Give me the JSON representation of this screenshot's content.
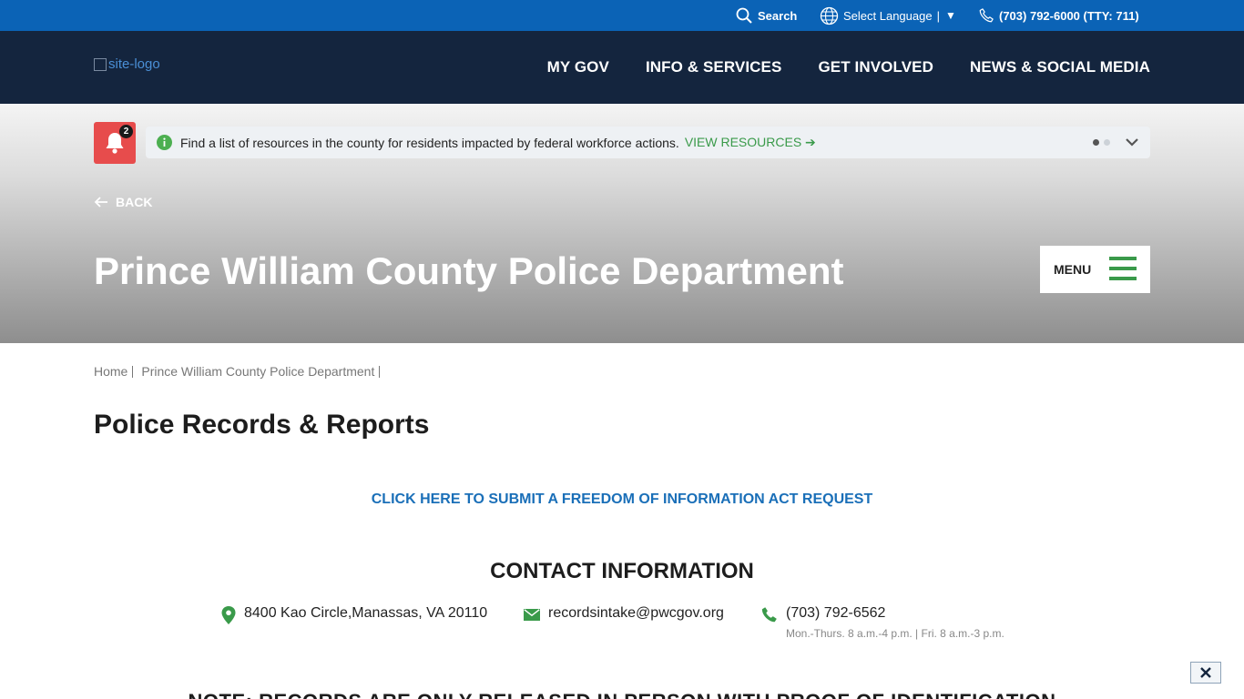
{
  "utility": {
    "search_label": "Search",
    "language_label": "Select Language",
    "language_separator": "|",
    "language_caret": "▼",
    "phone_label": "(703) 792-6000 (TTY: 711)"
  },
  "header": {
    "logo_alt": "site-logo",
    "nav": [
      {
        "label": "MY GOV"
      },
      {
        "label": "INFO & SERVICES"
      },
      {
        "label": "GET INVOLVED"
      },
      {
        "label": "NEWS & SOCIAL MEDIA"
      }
    ]
  },
  "alert": {
    "count": "2",
    "message": "Find a list of resources in the county for residents impacted by federal workforce actions.",
    "link_label": "VIEW RESOURCES ➔"
  },
  "hero": {
    "back_label": "BACK",
    "title": "Prince William County Police Department",
    "menu_label": "MENU"
  },
  "breadcrumb": [
    {
      "label": "Home"
    },
    {
      "label": "Prince William County Police Department"
    }
  ],
  "page": {
    "heading": "Police Records & Reports",
    "foia_link": "CLICK HERE TO SUBMIT A FREEDOM OF INFORMATION ACT REQUEST",
    "contact_heading": "CONTACT INFORMATION",
    "address": "8400 Kao Circle,Manassas, VA 20110",
    "email": "recordsintake@pwcgov.org",
    "phone": "(703) 792-6562",
    "hours": "Mon.-Thurs. 8 a.m.-4 p.m. | Fri. 8 a.m.-3 p.m.",
    "note": "NOTE: RECORDS ARE ONLY RELEASED IN PERSON WITH PROOF OF IDENTIFICATION"
  },
  "colors": {
    "utility_bar": "#0b63b6",
    "nav_bar": "#14253e",
    "accent_green": "#3a9a4a",
    "alert_red": "#e74c4c",
    "link_blue": "#1a6fb8"
  },
  "icons": {
    "search": "search-icon",
    "globe": "globe-icon",
    "phone": "phone-icon",
    "bell": "bell-icon",
    "info": "info-icon",
    "chevron": "chevron-down-icon",
    "back": "arrow-left-icon",
    "menu": "hamburger-icon",
    "map_pin": "map-pin-icon",
    "envelope": "envelope-icon",
    "close": "close-icon"
  }
}
